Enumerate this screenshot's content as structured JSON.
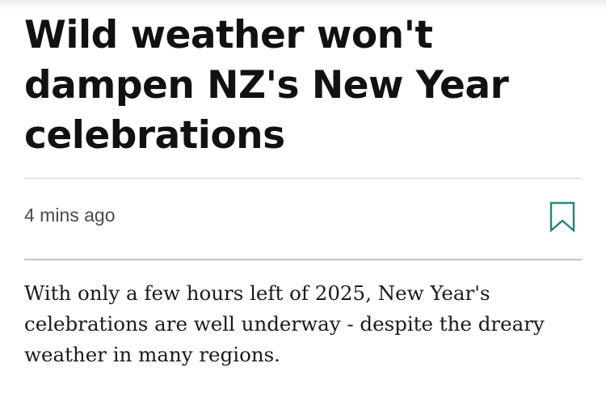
{
  "article": {
    "headline": "Wild weather won't dampen NZ's New Year celebrations",
    "timestamp": "4 mins ago",
    "summary": "With only a few hours left of 2025, New Year's celebrations are well underway - despite the dreary weather in many regions."
  },
  "icons": {
    "bookmark": "bookmark-icon"
  },
  "colors": {
    "bookmark_accent": "#1e8a78",
    "headline_text": "#111111",
    "timestamp_text": "#4a4a4a"
  }
}
